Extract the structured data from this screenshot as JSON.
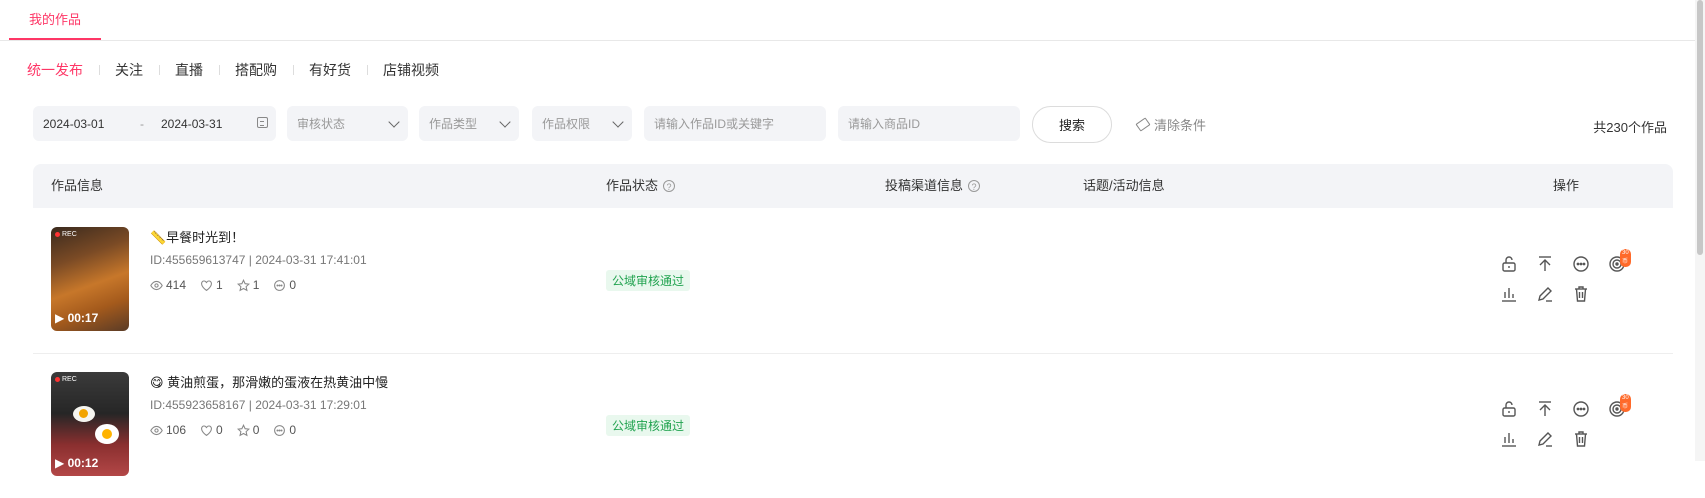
{
  "top_tab": {
    "label": "我的作品"
  },
  "sub_tabs": [
    "统一发布",
    "关注",
    "直播",
    "搭配购",
    "有好货",
    "店铺视频"
  ],
  "filters": {
    "date_start": "2024-03-01",
    "date_sep": "-",
    "date_end": "2024-03-31",
    "review_status_placeholder": "审核状态",
    "work_type_placeholder": "作品类型",
    "work_permission_placeholder": "作品权限",
    "keyword_placeholder": "请输入作品ID或关键字",
    "product_id_placeholder": "请输入商品ID",
    "search_label": "搜索",
    "clear_label": "清除条件",
    "total_text": "共230个作品"
  },
  "table_headers": {
    "info": "作品信息",
    "status": "作品状态",
    "channel": "投稿渠道信息",
    "topic": "话题/活动信息",
    "actions": "操作",
    "help_glyph": "?"
  },
  "rows": [
    {
      "title": "📏早餐时光到！",
      "meta": "ID:455659613747 | 2024-03-31 17:41:01",
      "views": "414",
      "likes": "1",
      "favorites": "1",
      "comments": "0",
      "status": "公域审核通过",
      "duration": "▶ 00:17",
      "rec": "REC",
      "badge": "30币"
    },
    {
      "title": "😋 黄油煎蛋，那滑嫩的蛋液在热黄油中慢",
      "meta": "ID:455923658167 | 2024-03-31 17:29:01",
      "views": "106",
      "likes": "0",
      "favorites": "0",
      "comments": "0",
      "status": "公域审核通过",
      "duration": "▶ 00:12",
      "rec": "REC",
      "badge": "30币"
    }
  ],
  "colors": {
    "accent": "#fe3666",
    "success": "#22a350"
  }
}
